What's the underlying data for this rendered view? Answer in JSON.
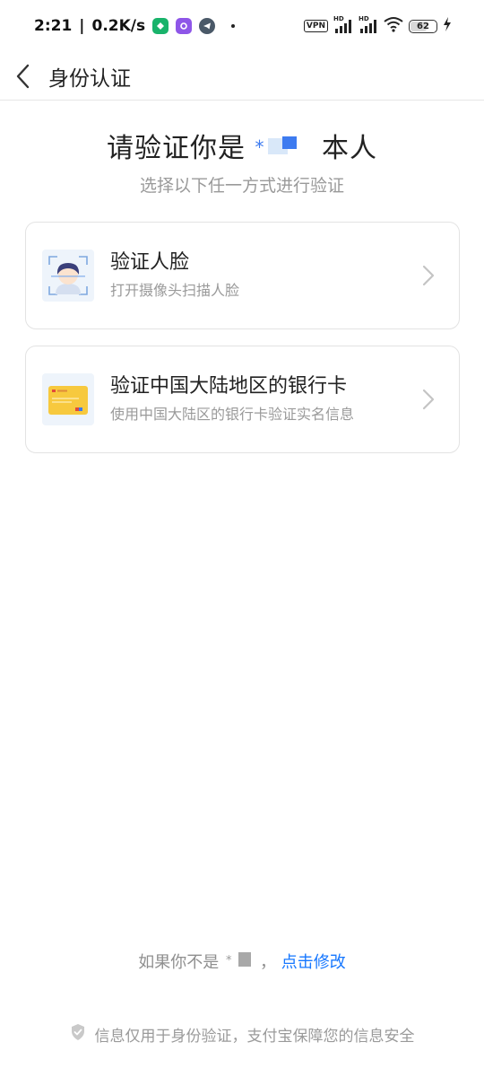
{
  "status_bar": {
    "time": "2:21",
    "network_speed": "0.2K/s",
    "vpn_label": "VPN",
    "signal1_label": "HD",
    "signal2_label": "HD",
    "battery_level": "62",
    "icons": [
      "app-green-icon",
      "app-purple-icon",
      "telegram-icon",
      "wifi-icon",
      "charging-icon"
    ]
  },
  "nav": {
    "title": "身份认证"
  },
  "header": {
    "title_prefix": "请验证你是",
    "masked_name_star": "*",
    "title_suffix": "本人",
    "subtitle": "选择以下任一方式进行验证"
  },
  "options": [
    {
      "title": "验证人脸",
      "description": "打开摄像头扫描人脸",
      "icon": "face-scan-icon"
    },
    {
      "title": "验证中国大陆地区的银行卡",
      "description": "使用中国大陆区的银行卡验证实名信息",
      "icon": "bank-card-icon"
    }
  ],
  "footer": {
    "not_you_prefix": "如果你不是",
    "masked_name_star": "*",
    "not_you_comma": "，",
    "change_link": "点击修改",
    "security_note": "信息仅用于身份验证，支付宝保障您的信息安全"
  },
  "colors": {
    "accent": "#1677ff",
    "text_primary": "#222222",
    "text_secondary": "#9a9a9a",
    "card_border": "#e3e3e3"
  }
}
